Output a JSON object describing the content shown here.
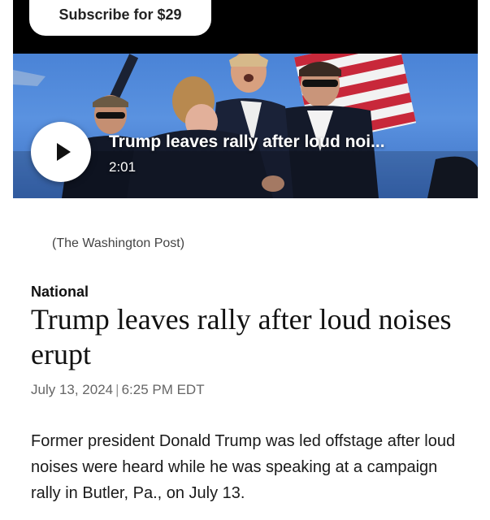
{
  "header": {
    "subscribe_label": "Subscribe for $29"
  },
  "video": {
    "title": "Trump leaves rally after loud noi...",
    "duration": "2:01",
    "play_icon": "play-icon"
  },
  "photo_credit": "(The Washington Post)",
  "article": {
    "section": "National",
    "headline": "Trump leaves rally after loud noises erupt",
    "date": "July 13, 2024",
    "date_separator": "|",
    "time": "6:25 PM EDT",
    "lead": "Former president Donald Trump was led offstage after loud noises were heard while he was speaking at a campaign rally in Butler, Pa., on July 13."
  },
  "colors": {
    "top_bar": "#000000",
    "sky": "#4a83d6",
    "flag_red": "#c8283a"
  }
}
